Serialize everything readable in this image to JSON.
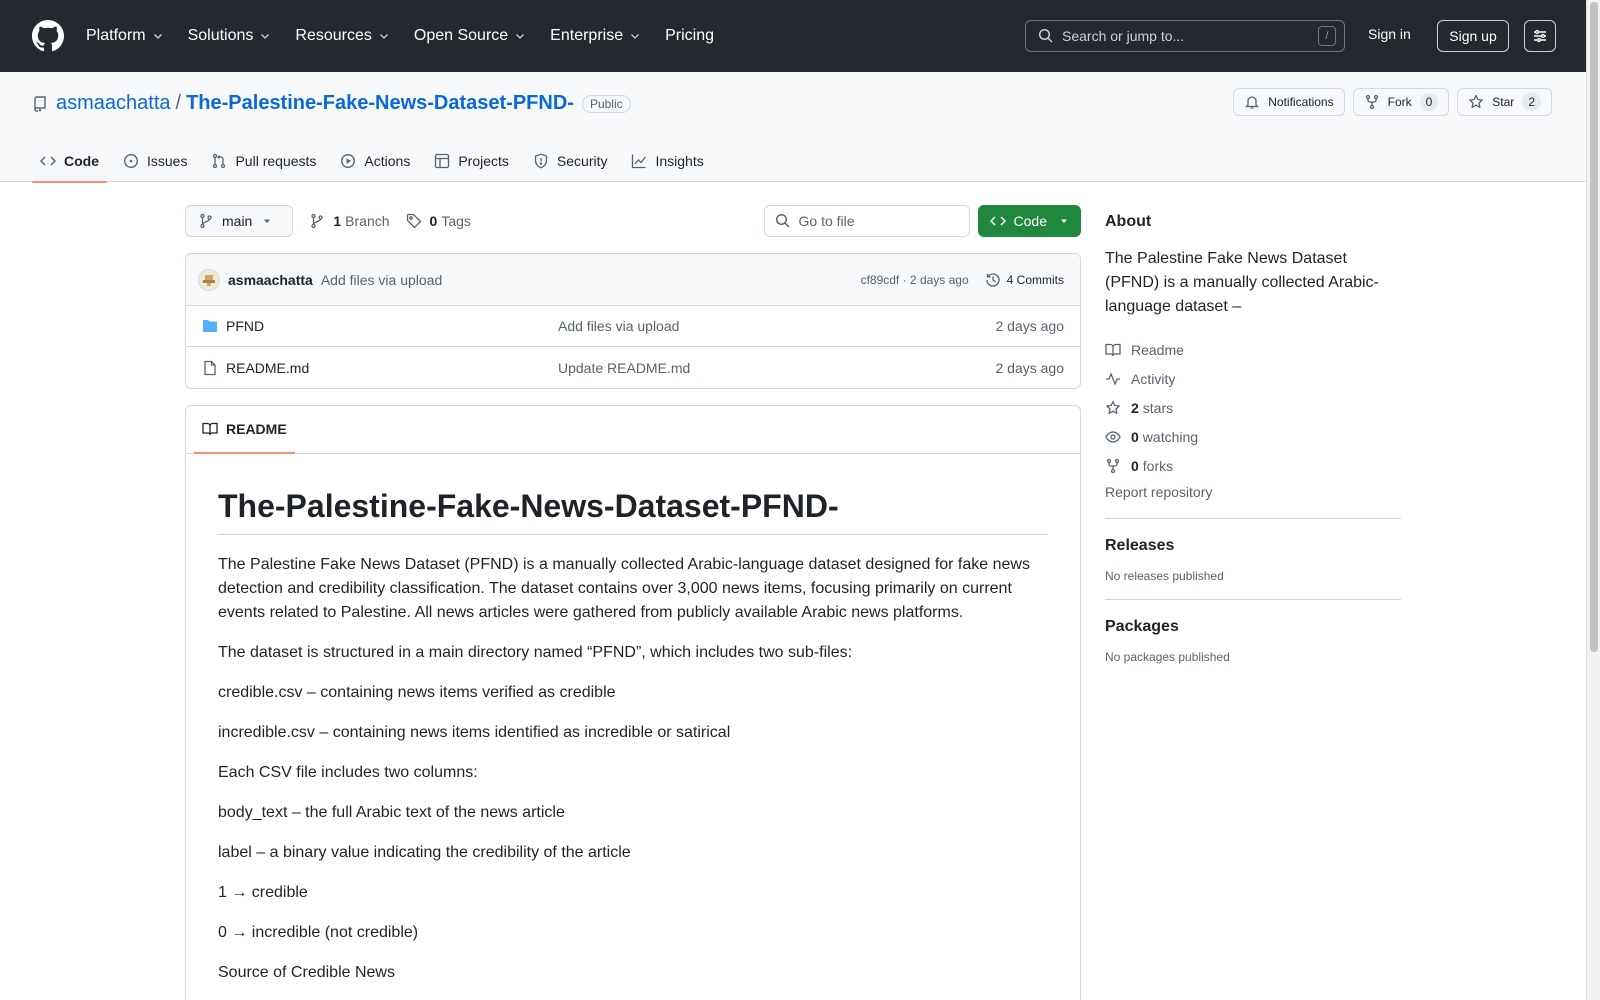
{
  "header": {
    "nav": [
      {
        "label": "Platform",
        "has_menu": true
      },
      {
        "label": "Solutions",
        "has_menu": true
      },
      {
        "label": "Resources",
        "has_menu": true
      },
      {
        "label": "Open Source",
        "has_menu": true
      },
      {
        "label": "Enterprise",
        "has_menu": true
      },
      {
        "label": "Pricing",
        "has_menu": false
      }
    ],
    "search_placeholder": "Search or jump to...",
    "search_shortcut": "/",
    "sign_in": "Sign in",
    "sign_up": "Sign up"
  },
  "repo": {
    "owner": "asmaachatta",
    "separator": "/",
    "name": "The-Palestine-Fake-News-Dataset-PFND-",
    "visibility": "Public",
    "notifications_label": "Notifications",
    "fork_label": "Fork",
    "fork_count": "0",
    "star_label": "Star",
    "star_count": "2",
    "tabs": [
      {
        "label": "Code",
        "icon": "code-icon",
        "active": true
      },
      {
        "label": "Issues",
        "icon": "issue-icon",
        "active": false
      },
      {
        "label": "Pull requests",
        "icon": "pull-request-icon",
        "active": false
      },
      {
        "label": "Actions",
        "icon": "play-icon",
        "active": false
      },
      {
        "label": "Projects",
        "icon": "table-icon",
        "active": false
      },
      {
        "label": "Security",
        "icon": "shield-icon",
        "active": false
      },
      {
        "label": "Insights",
        "icon": "graph-icon",
        "active": false
      }
    ]
  },
  "toolbar": {
    "branch": "main",
    "branch_count": "1",
    "branch_label": "Branch",
    "tag_count": "0",
    "tag_label": "Tags",
    "goto_placeholder": "Go to file",
    "code_label": "Code"
  },
  "commit": {
    "author": "asmaachatta",
    "message": "Add files via upload",
    "hash_time": "cf89cdf · 2 days ago",
    "commits_label": "4 Commits"
  },
  "files": [
    {
      "type": "folder",
      "name": "PFND",
      "message": "Add files via upload",
      "date": "2 days ago"
    },
    {
      "type": "file",
      "name": "README.md",
      "message": "Update README.md",
      "date": "2 days ago"
    }
  ],
  "readme": {
    "tab_label": "README",
    "title": "The-Palestine-Fake-News-Dataset-PFND-",
    "paragraphs": [
      "The Palestine Fake News Dataset (PFND) is a manually collected Arabic-language dataset designed for fake news detection and credibility classification. The dataset contains over 3,000 news items, focusing primarily on current events related to Palestine. All news articles were gathered from publicly available Arabic news platforms.",
      "The dataset is structured in a main directory named “PFND”, which includes two sub-files:",
      "credible.csv – containing news items verified as credible",
      "incredible.csv – containing news items identified as incredible or satirical",
      "Each CSV file includes two columns:",
      "body_text – the full Arabic text of the news article",
      "label – a binary value indicating the credibility of the article",
      "1 → credible",
      "0 → incredible (not credible)",
      "Source of Credible News"
    ]
  },
  "sidebar": {
    "about_title": "About",
    "description": "The Palestine Fake News Dataset (PFND) is a manually collected Arabic-language dataset –",
    "readme_label": "Readme",
    "activity_label": "Activity",
    "stars_count": "2",
    "stars_label": "stars",
    "watching_count": "0",
    "watching_label": "watching",
    "forks_count": "0",
    "forks_label": "forks",
    "report_label": "Report repository",
    "releases_title": "Releases",
    "releases_empty": "No releases published",
    "packages_title": "Packages",
    "packages_empty": "No packages published"
  },
  "colors": {
    "header_bg": "#24292f",
    "link": "#0969da",
    "green": "#1f883d",
    "active_tab_underline": "#fd8c73",
    "folder": "#54aeff"
  }
}
